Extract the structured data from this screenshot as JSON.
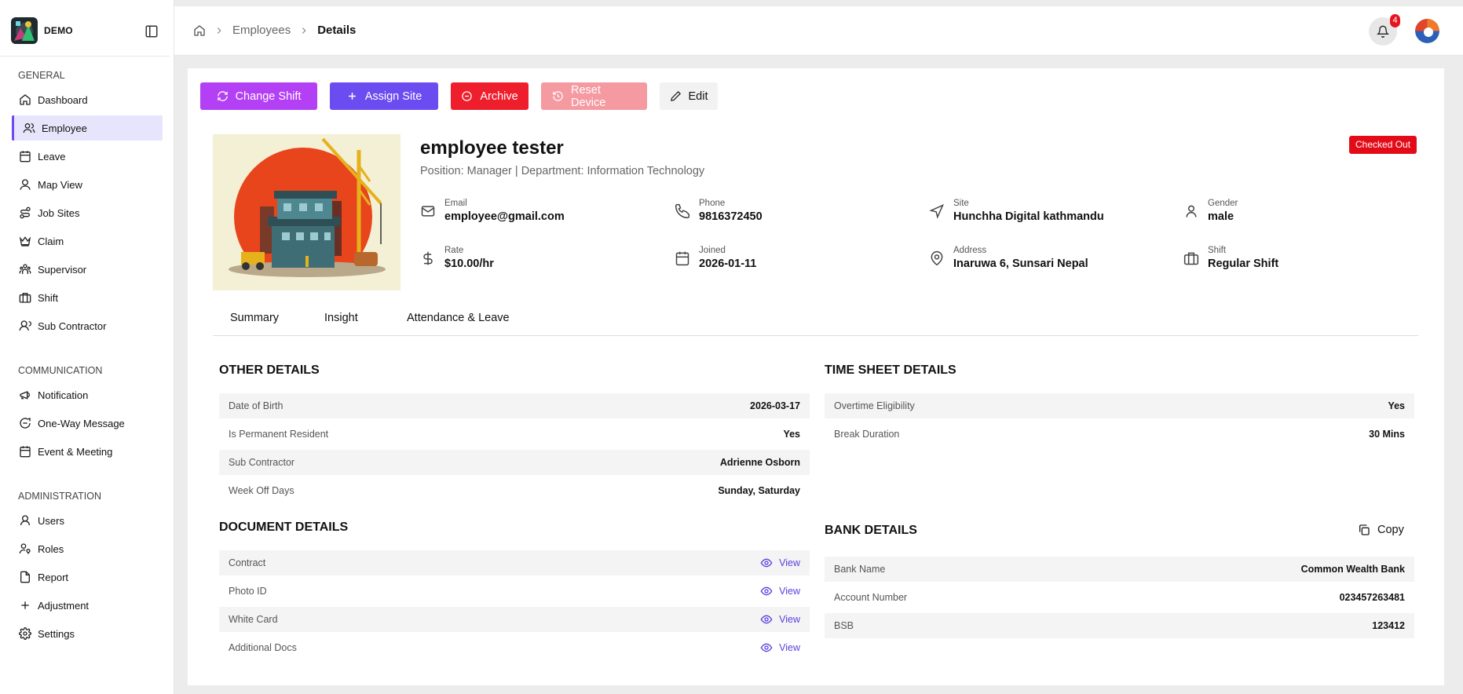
{
  "brand": {
    "name": "DEMO"
  },
  "sidebar": {
    "general": {
      "heading": "GENERAL",
      "items": [
        {
          "label": "Dashboard",
          "icon": "home-icon"
        },
        {
          "label": "Employee",
          "icon": "users-icon",
          "active": true
        },
        {
          "label": "Leave",
          "icon": "calendar-icon"
        },
        {
          "label": "Map View",
          "icon": "map-pin-user-icon"
        },
        {
          "label": "Job Sites",
          "icon": "route-icon"
        },
        {
          "label": "Claim",
          "icon": "crown-icon"
        },
        {
          "label": "Supervisor",
          "icon": "supervisor-icon"
        },
        {
          "label": "Shift",
          "icon": "briefcase-icon"
        },
        {
          "label": "Sub Contractor",
          "icon": "user-round-icon"
        }
      ]
    },
    "communication": {
      "heading": "COMMUNICATION",
      "items": [
        {
          "label": "Notification",
          "icon": "megaphone-icon"
        },
        {
          "label": "One-Way Message",
          "icon": "message-icon"
        },
        {
          "label": "Event & Meeting",
          "icon": "calendar-icon"
        }
      ]
    },
    "administration": {
      "heading": "ADMINISTRATION",
      "items": [
        {
          "label": "Users",
          "icon": "user-icon"
        },
        {
          "label": "Roles",
          "icon": "user-key-icon"
        },
        {
          "label": "Report",
          "icon": "file-icon"
        },
        {
          "label": "Adjustment",
          "icon": "plus-icon"
        },
        {
          "label": "Settings",
          "icon": "gear-icon"
        }
      ]
    }
  },
  "header": {
    "breadcrumb": {
      "parent": "Employees",
      "current": "Details"
    },
    "notifications_count": "4"
  },
  "actions": {
    "change_shift": "Change Shift",
    "assign_site": "Assign Site",
    "archive": "Archive",
    "reset_device": "Reset Device",
    "edit": "Edit"
  },
  "employee": {
    "name": "employee tester",
    "subtitle": "Position: Manager | Department: Information Technology",
    "status": "Checked Out",
    "fields": {
      "email": {
        "label": "Email",
        "value": "employee@gmail.com"
      },
      "phone": {
        "label": "Phone",
        "value": "9816372450"
      },
      "site": {
        "label": "Site",
        "value": "Hunchha Digital kathmandu"
      },
      "gender": {
        "label": "Gender",
        "value": "male"
      },
      "rate": {
        "label": "Rate",
        "value": "$10.00/hr"
      },
      "joined": {
        "label": "Joined",
        "value": "2026-01-11"
      },
      "address": {
        "label": "Address",
        "value": "Inaruwa 6, Sunsari Nepal"
      },
      "shift": {
        "label": "Shift",
        "value": "Regular Shift"
      }
    }
  },
  "tabs": [
    "Summary",
    "Insight",
    "Attendance & Leave"
  ],
  "other_details": {
    "title": "OTHER DETAILS",
    "rows": [
      {
        "label": "Date of Birth",
        "value": "2026-03-17"
      },
      {
        "label": "Is Permanent Resident",
        "value": "Yes"
      },
      {
        "label": "Sub Contractor",
        "value": "Adrienne Osborn"
      },
      {
        "label": "Week Off Days",
        "value": "Sunday, Saturday"
      }
    ]
  },
  "timesheet_details": {
    "title": "TIME SHEET DETAILS",
    "rows": [
      {
        "label": "Overtime Eligibility",
        "value": "Yes"
      },
      {
        "label": "Break Duration",
        "value": "30 Mins"
      }
    ]
  },
  "document_details": {
    "title": "DOCUMENT DETAILS",
    "view_label": "View",
    "rows": [
      {
        "label": "Contract"
      },
      {
        "label": "Photo ID"
      },
      {
        "label": "White Card"
      },
      {
        "label": "Additional Docs"
      }
    ]
  },
  "bank_details": {
    "title": "BANK DETAILS",
    "copy_label": "Copy",
    "rows": [
      {
        "label": "Bank Name",
        "value": "Common Wealth Bank"
      },
      {
        "label": "Account Number",
        "value": "023457263481"
      },
      {
        "label": "BSB",
        "value": "123412"
      }
    ]
  },
  "colors": {
    "accent": "#6d4bf0",
    "change_shift": "#b340f4",
    "assign_site": "#6b4cf0",
    "archive": "#ef1e2d",
    "reset_device": "#f59aa1",
    "status_badge": "#e40b18",
    "link": "#5b3fe0"
  }
}
